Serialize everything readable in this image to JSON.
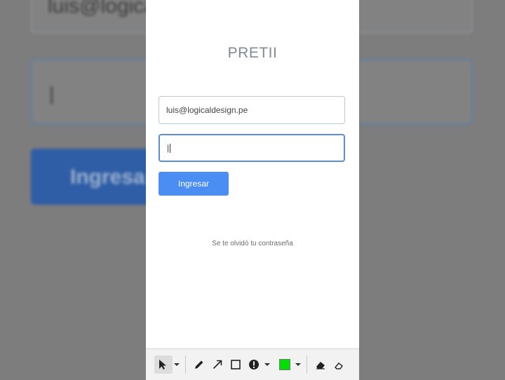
{
  "background": {
    "email_fragment": "luis@logica",
    "cursor": "|",
    "button_fragment": "Ingresa"
  },
  "login": {
    "brand": "PRETII",
    "email_value": "luis@logicaldesign.pe",
    "password_value": "|",
    "submit_label": "Ingresar",
    "forgot_link": "Se te olvidó tu contraseña"
  },
  "toolbar": {
    "tools": [
      "select-pointer-icon",
      "pencil-icon",
      "arrow-icon",
      "rectangle-icon",
      "exclamation-marker-icon",
      "color-swatch",
      "eraser-icon"
    ],
    "color": "#00e000"
  },
  "colors": {
    "accent": "#4a8ef3",
    "focus_border": "#5b8fd3"
  }
}
